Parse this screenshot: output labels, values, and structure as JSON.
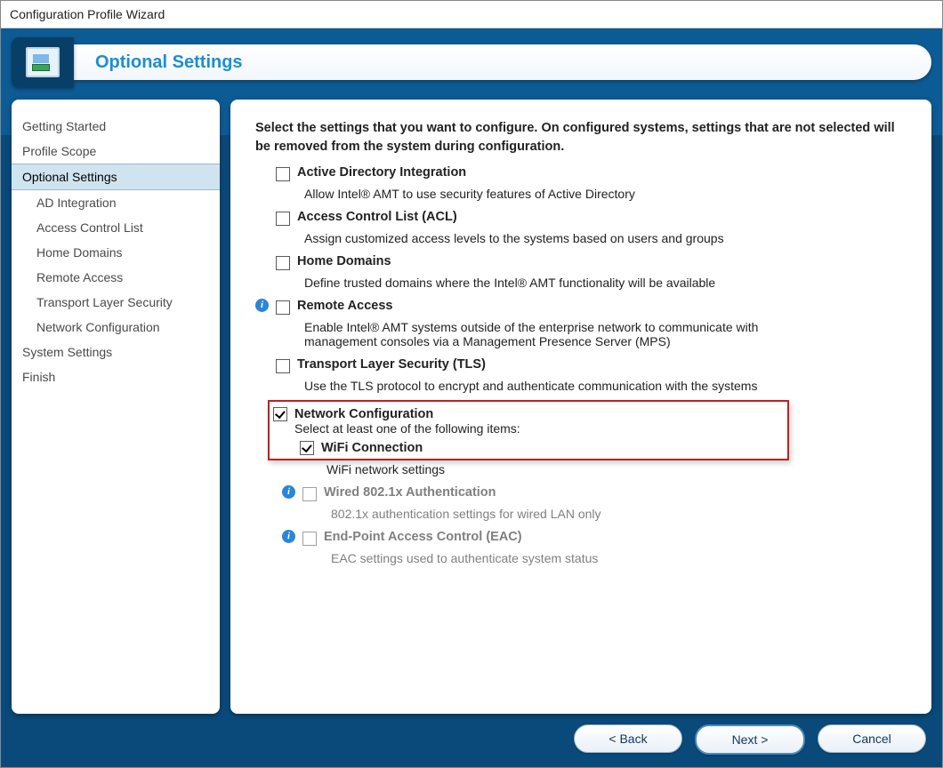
{
  "window": {
    "title": "Configuration Profile Wizard"
  },
  "header": {
    "title": "Optional Settings"
  },
  "nav": {
    "items": [
      {
        "label": "Getting Started",
        "selected": false,
        "indent": 0
      },
      {
        "label": "Profile Scope",
        "selected": false,
        "indent": 0
      },
      {
        "label": "Optional Settings",
        "selected": true,
        "indent": 0
      },
      {
        "label": "AD Integration",
        "selected": false,
        "indent": 1
      },
      {
        "label": "Access Control List",
        "selected": false,
        "indent": 1
      },
      {
        "label": "Home Domains",
        "selected": false,
        "indent": 1
      },
      {
        "label": "Remote Access",
        "selected": false,
        "indent": 1
      },
      {
        "label": "Transport Layer Security",
        "selected": false,
        "indent": 1
      },
      {
        "label": "Network Configuration",
        "selected": false,
        "indent": 1
      },
      {
        "label": "System Settings",
        "selected": false,
        "indent": 0
      },
      {
        "label": "Finish",
        "selected": false,
        "indent": 0
      }
    ]
  },
  "content": {
    "intro": "Select the settings that you want to configure. On configured systems, settings that are not selected will be removed from the system during configuration.",
    "options": {
      "ad": {
        "title": "Active Directory Integration",
        "desc": "Allow Intel® AMT to use security features of Active Directory",
        "checked": false
      },
      "acl": {
        "title": "Access Control List (ACL)",
        "desc": "Assign customized access levels to the systems based on users and groups",
        "checked": false
      },
      "home": {
        "title": "Home Domains",
        "desc": "Define trusted domains where the Intel® AMT functionality will be available",
        "checked": false
      },
      "remote": {
        "title": "Remote Access",
        "desc": "Enable Intel® AMT systems outside of the enterprise network to communicate with management consoles via a Management Presence Server (MPS)",
        "checked": false,
        "info": true
      },
      "tls": {
        "title": "Transport Layer Security (TLS)",
        "desc": "Use the TLS protocol to encrypt and authenticate communication with the systems",
        "checked": false
      },
      "net": {
        "title": "Network Configuration",
        "sub_intro": "Select at least one of the following items:",
        "checked": true,
        "wifi": {
          "title": "WiFi Connection",
          "desc": "WiFi network settings",
          "checked": true
        },
        "wired": {
          "title": "Wired 802.1x Authentication",
          "desc": "802.1x authentication settings for wired LAN only",
          "checked": false,
          "info": true,
          "disabled": true
        },
        "eac": {
          "title": "End-Point Access Control (EAC)",
          "desc": "EAC settings used to authenticate system status",
          "checked": false,
          "info": true,
          "disabled": true
        }
      }
    }
  },
  "footer": {
    "back": "< Back",
    "next": "Next >",
    "cancel": "Cancel"
  }
}
